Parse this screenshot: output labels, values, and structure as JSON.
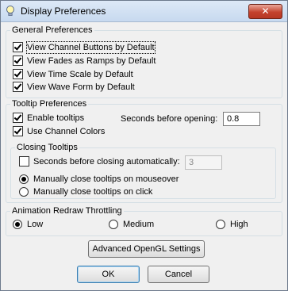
{
  "window": {
    "title": "Display Preferences",
    "close_glyph": "✕"
  },
  "general": {
    "legend": "General Preferences",
    "options": [
      {
        "label": "View Channel Buttons by Default",
        "checked": true
      },
      {
        "label": "View Fades as Ramps by Default",
        "checked": true
      },
      {
        "label": "View Time Scale by Default",
        "checked": true
      },
      {
        "label": "View Wave Form by Default",
        "checked": true
      }
    ]
  },
  "tooltip": {
    "legend": "Tooltip Preferences",
    "enable_label": "Enable tooltips",
    "enable_checked": true,
    "channel_colors_label": "Use Channel Colors",
    "channel_colors_checked": true,
    "seconds_before_opening_label": "Seconds before opening:",
    "seconds_before_opening_value": "0.8",
    "closing": {
      "legend": "Closing Tooltips",
      "auto_label": "Seconds before closing automatically:",
      "auto_checked": false,
      "auto_value": "3",
      "mouseover_label": "Manually close tooltips on mouseover",
      "click_label": "Manually close tooltips on click",
      "selected": "mouseover"
    }
  },
  "animation": {
    "legend": "Animation Redraw Throttling",
    "options": [
      "Low",
      "Medium",
      "High"
    ],
    "selected": "Low"
  },
  "buttons": {
    "advanced": "Advanced OpenGL Settings",
    "ok": "OK",
    "cancel": "Cancel"
  },
  "icons": {
    "title_icon": "lightbulb-icon",
    "close_icon": "close-icon"
  },
  "colors": {
    "titlebar": "#c7d9ef",
    "close_button": "#c4422d",
    "dialog_bg": "#f0f0f0"
  }
}
